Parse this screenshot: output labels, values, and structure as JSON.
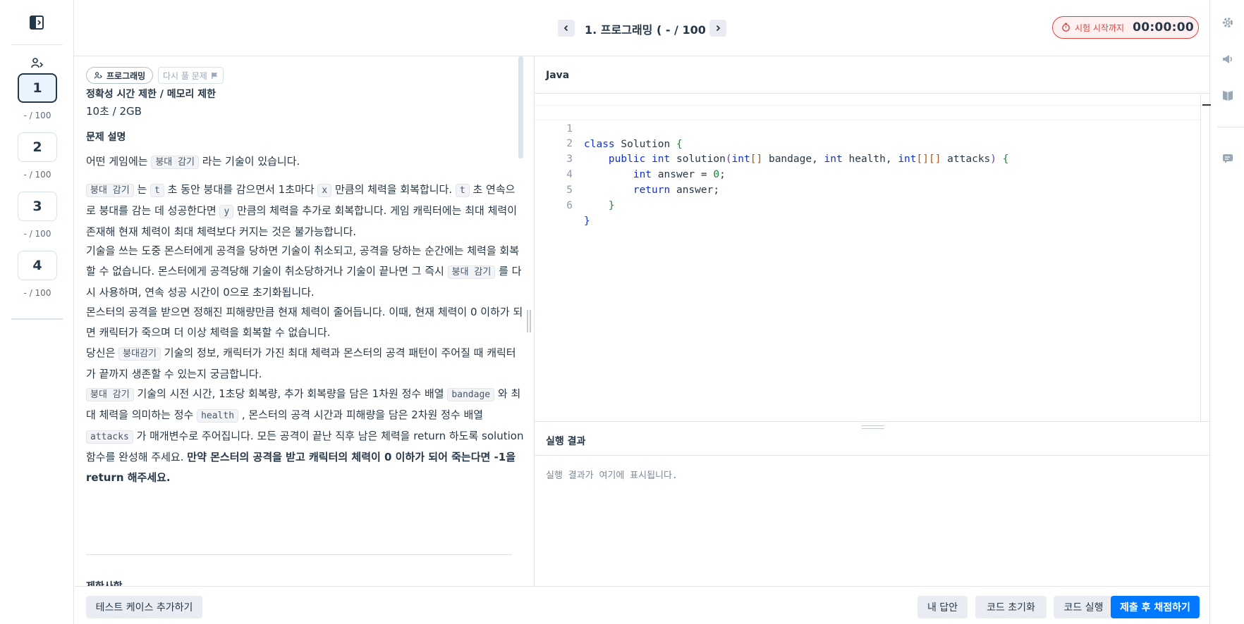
{
  "left_rail": {
    "questions": [
      {
        "num": "1",
        "score": "- / 100"
      },
      {
        "num": "2",
        "score": "- / 100"
      },
      {
        "num": "3",
        "score": "- / 100"
      },
      {
        "num": "4",
        "score": "- / 100"
      }
    ],
    "active_index": 0
  },
  "header": {
    "title": "1. 프로그래밍 ( - / 100 )",
    "timer_label": "시험 시작까지",
    "timer_value": "00:00:00"
  },
  "description": {
    "tag_category": "프로그래밍",
    "tag_retry": "다시 풀 문제",
    "limit_title": "정확성 시간 제한 / 메모리 제한",
    "limit_value": "10초 / 2GB",
    "desc_title": "문제 설명",
    "p1_a": "어떤 게임에는 ",
    "p1_code": "붕대 감기",
    "p1_b": " 라는 기술이 있습니다.",
    "p2_code1": "붕대 감기",
    "p2_a": " 는 ",
    "p2_code2": "t",
    "p2_b": " 초 동안 붕대를 감으면서 1초마다 ",
    "p2_code3": "x",
    "p2_c": " 만큼의 체력을 회복합니다. ",
    "p2_code4": "t",
    "p2_d": " 초 연속으로 붕대를 감는 데 성공한다면 ",
    "p2_code5": "y",
    "p2_e": " 만큼의 체력을 추가로 회복합니다. 게임 캐릭터에는 최대 체력이 존재해 현재 체력이 최대 체력보다 커지는 것은 불가능합니다.",
    "p3_a": "기술을 쓰는 도중 몬스터에게 공격을 당하면 기술이 취소되고, 공격을 당하는 순간에는 체력을 회복할 수 없습니다. 몬스터에게 공격당해 기술이 취소당하거나 기술이 끝나면 그 즉시 ",
    "p3_code": "붕대 감기",
    "p3_b": " 를 다시 사용하며, 연속 성공 시간이 0으로 초기화됩니다.",
    "p4": "몬스터의 공격을 받으면 정해진 피해량만큼 현재 체력이 줄어듭니다. 이때, 현재 체력이 0 이하가 되면 캐릭터가 죽으며 더 이상 체력을 회복할 수 없습니다.",
    "p5_a": "당신은 ",
    "p5_code": "붕대감기",
    "p5_b": " 기술의 정보, 캐릭터가 가진 최대 체력과 몬스터의 공격 패턴이 주어질 때 캐릭터가 끝까지 생존할 수 있는지 궁금합니다.",
    "p6_code1": "붕대 감기",
    "p6_a": " 기술의 시전 시간, 1초당 회복량, 추가 회복량을 담은 1차원 정수 배열 ",
    "p6_code2": "bandage",
    "p6_b": " 와 최대 체력을 의미하는 정수 ",
    "p6_code3": "health",
    "p6_c": " , 몬스터의 공격 시간과 피해량을 담은 2차원 정수 배열 ",
    "p6_code4": "attacks",
    "p6_d": " 가 매개변수로 주어집니다. 모든 공격이 끝난 직후 남은 체력을 return 하도록 solution 함수를 완성해 주세요. ",
    "p6_bold": "만약 몬스터의 공격을 받고 캐릭터의 체력이 0 이하가 되어 죽는다면 -1을 return 해주세요.",
    "next_title": "제한사항"
  },
  "editor": {
    "language": "Java",
    "lines": [
      {
        "n": "1"
      },
      {
        "n": "2"
      },
      {
        "n": "3"
      },
      {
        "n": "4"
      },
      {
        "n": "5"
      },
      {
        "n": "6"
      }
    ],
    "code_text": [
      "class Solution {",
      "    public int solution(int[] bandage, int health, int[][] attacks) {",
      "        int answer = 0;",
      "        return answer;",
      "    }",
      "}"
    ]
  },
  "result": {
    "title": "실행 결과",
    "placeholder": "실행 결과가 여기에 표시됩니다."
  },
  "footer": {
    "add_testcase": "테스트 케이스 추가하기",
    "my_answer": "내 답안",
    "reset_code": "코드 초기화",
    "run_code": "코드 실행",
    "submit": "제출 후 채점하기"
  },
  "colors": {
    "primary": "#0078ff",
    "timer_red": "#e0423b",
    "active_box_bg": "#e9f4ff",
    "keyword": "#1433c4"
  },
  "icons": {
    "panel_toggle": "panel-toggle-icon",
    "programming": "programming-icon",
    "flag": "flag-icon",
    "prev": "chevron-left-icon",
    "next": "chevron-right-icon",
    "stopwatch": "stopwatch-icon",
    "settings": "gear-icon",
    "announce": "megaphone-icon",
    "guide": "book-icon",
    "feedback": "feedback-icon"
  }
}
